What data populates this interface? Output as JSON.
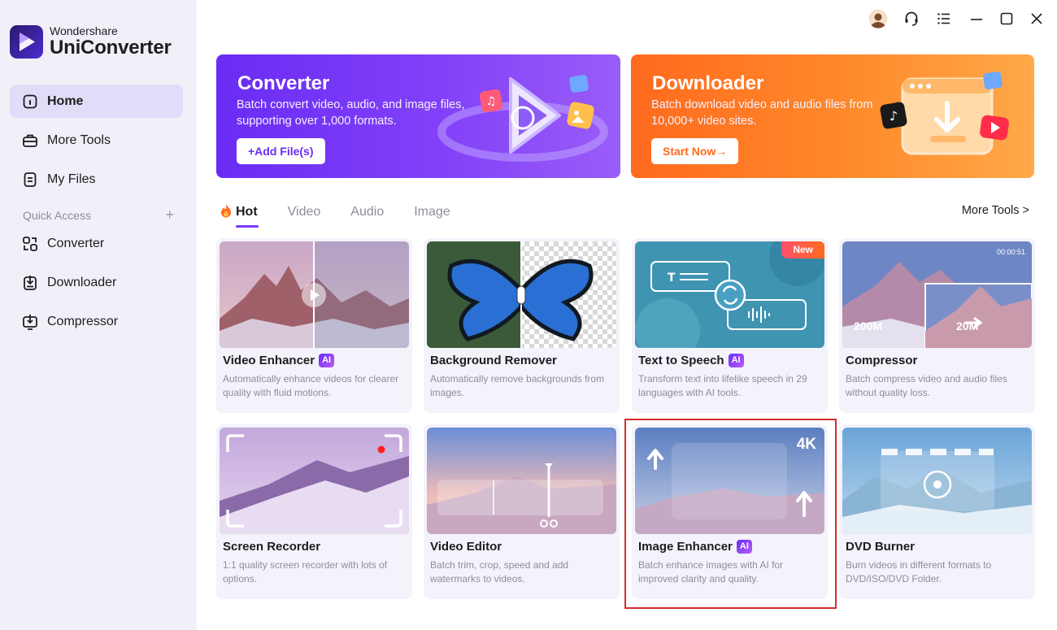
{
  "app": {
    "brand_small": "Wondershare",
    "brand_big": "UniConverter"
  },
  "sidebar": {
    "items": [
      {
        "label": "Home",
        "icon": "home-icon",
        "active": true
      },
      {
        "label": "More Tools",
        "icon": "toolbox-icon",
        "active": false
      },
      {
        "label": "My Files",
        "icon": "file-icon",
        "active": false
      }
    ],
    "quick_access_label": "Quick Access",
    "quick_access_plus": "+",
    "quick_items": [
      {
        "label": "Converter",
        "icon": "converter-icon"
      },
      {
        "label": "Downloader",
        "icon": "downloader-icon"
      },
      {
        "label": "Compressor",
        "icon": "compressor-icon"
      }
    ]
  },
  "window_controls": [
    "avatar",
    "headset-icon",
    "menu-icon",
    "minimize-icon",
    "maximize-icon",
    "close-icon"
  ],
  "banners": {
    "converter": {
      "title": "Converter",
      "desc": "Batch convert video, audio, and image files, supporting over 1,000 formats.",
      "button": "+Add File(s)"
    },
    "downloader": {
      "title": "Downloader",
      "desc": "Batch download video and audio files from 10,000+ video sites.",
      "button": "Start Now→"
    }
  },
  "tabs": [
    {
      "label": "Hot",
      "active": true
    },
    {
      "label": "Video",
      "active": false
    },
    {
      "label": "Audio",
      "active": false
    },
    {
      "label": "Image",
      "active": false
    }
  ],
  "more_tools_link": "More Tools  >",
  "cards": [
    {
      "title": "Video Enhancer",
      "ai": true,
      "desc": "Automatically enhance videos for clearer quality with fluid motions."
    },
    {
      "title": "Background Remover",
      "ai": false,
      "desc": "Automatically remove backgrounds from images."
    },
    {
      "title": "Text to Speech",
      "ai": true,
      "new": "New",
      "desc": "Transform text into lifelike speech in 29 languages with AI tools."
    },
    {
      "title": "Compressor",
      "ai": false,
      "desc": "Batch compress video and audio files without quality loss.",
      "thumb_text": {
        "from": "200M",
        "to": "20M",
        "time": "00:00:51"
      }
    },
    {
      "title": "Screen Recorder",
      "ai": false,
      "desc": "1:1 quality screen recorder with lots of options."
    },
    {
      "title": "Video Editor",
      "ai": false,
      "desc": "Batch trim, crop, speed and add watermarks to videos."
    },
    {
      "title": "Image Enhancer",
      "ai": true,
      "desc": "Batch enhance images with AI for improved clarity and quality.",
      "thumb_text": {
        "res": "4K"
      }
    },
    {
      "title": "DVD Burner",
      "ai": false,
      "desc": "Burn videos in different formats to DVD/ISO/DVD Folder."
    }
  ],
  "ai_badge": "AI",
  "colors": {
    "accent": "#7a3cf4",
    "sidebar_bg": "#f1f0f8",
    "active_nav": "#e3dcf8",
    "converter_banner": "#6a2cf4",
    "downloader_banner": "#ff6a1e",
    "highlight": "#d32f2f"
  }
}
